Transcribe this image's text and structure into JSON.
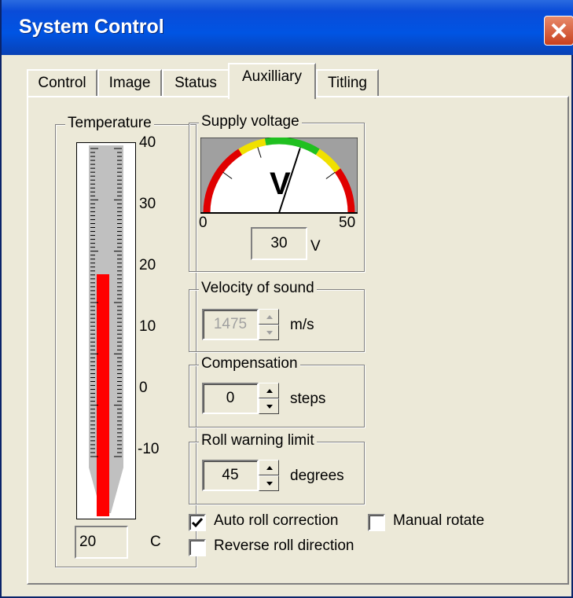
{
  "window": {
    "title": "System Control"
  },
  "tabs": [
    {
      "label": "Control",
      "active": false
    },
    {
      "label": "Image",
      "active": false
    },
    {
      "label": "Status",
      "active": false
    },
    {
      "label": "Auxilliary",
      "active": true
    },
    {
      "label": "Titling",
      "active": false
    }
  ],
  "temperature": {
    "group_label": "Temperature",
    "ticks": [
      "40",
      "30",
      "20",
      "10",
      "0",
      "-10"
    ],
    "scale_min": -20,
    "scale_max": 40,
    "value": 20,
    "readout": "20",
    "unit": "C",
    "fill_color": "#ff0000"
  },
  "supply_voltage": {
    "group_label": "Supply voltage",
    "gauge_letter": "V",
    "min_label": "0",
    "max_label": "50",
    "value": 30,
    "readout": "30",
    "unit": "V"
  },
  "velocity_of_sound": {
    "group_label": "Velocity of sound",
    "value": "1475",
    "unit": "m/s",
    "disabled": true
  },
  "compensation": {
    "group_label": "Compensation",
    "value": "0",
    "unit": "steps"
  },
  "roll_warning_limit": {
    "group_label": "Roll warning limit",
    "value": "45",
    "unit": "degrees"
  },
  "options": {
    "auto_roll_correction": {
      "label": "Auto roll correction",
      "checked": true
    },
    "manual_rotate": {
      "label": "Manual rotate",
      "checked": false
    },
    "reverse_roll_direction": {
      "label": "Reverse roll direction",
      "checked": false
    }
  }
}
